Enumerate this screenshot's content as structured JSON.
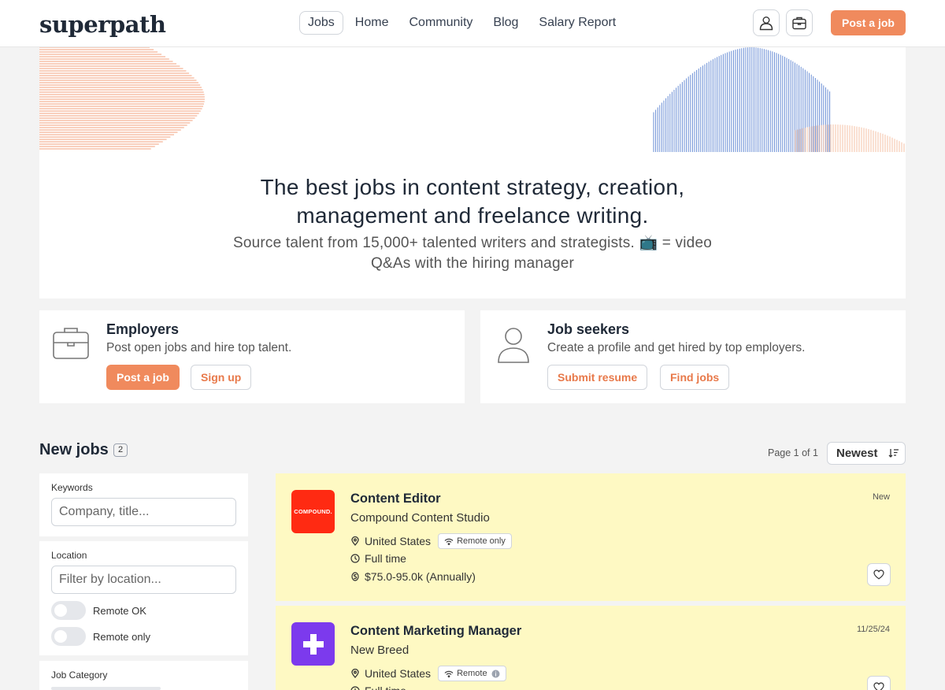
{
  "header": {
    "logo": "superpath",
    "nav": [
      "Jobs",
      "Home",
      "Community",
      "Blog",
      "Salary Report"
    ],
    "post_job": "Post a job",
    "icons": [
      "user-icon",
      "briefcase-icon"
    ]
  },
  "hero": {
    "title_line1": "The best jobs in content strategy, creation,",
    "title_line2": "management and freelance writing.",
    "subtitle_line1": "Source talent from 15,000+ talented writers and strategists. 📺 = video",
    "subtitle_line2": "Q&As with the hiring manager"
  },
  "employers": {
    "title": "Employers",
    "description": "Post open jobs and hire top talent.",
    "primary": "Post a job",
    "secondary": "Sign up"
  },
  "seekers": {
    "title": "Job seekers",
    "description": "Create a profile and get hired by top employers.",
    "primary": "Submit resume",
    "secondary": "Find jobs"
  },
  "jobs_section": {
    "title": "New jobs",
    "count": "2",
    "page_info": "Page 1 of 1",
    "sort": "Newest"
  },
  "filters": {
    "keywords_label": "Keywords",
    "keywords_placeholder": "Company, title...",
    "location_label": "Location",
    "location_placeholder": "Filter by location...",
    "remote_ok": "Remote OK",
    "remote_only": "Remote only",
    "category_label": "Job Category"
  },
  "jobs": [
    {
      "title": "Content Editor",
      "company": "Compound Content Studio",
      "logo_text": "COMPOUND.",
      "location": "United States",
      "remote": "Remote only",
      "type": "Full time",
      "salary": "$75.0-95.0k (Annually)",
      "date": "New"
    },
    {
      "title": "Content Marketing Manager",
      "company": "New Breed",
      "location": "United States",
      "remote": "Remote",
      "type": "Full time",
      "date": "11/25/24"
    }
  ],
  "colors": {
    "accent": "#f08a5d",
    "job_bg": "#fef9c3",
    "compound_logo": "#ff2a12",
    "newbreed_logo": "#7c3aed"
  }
}
